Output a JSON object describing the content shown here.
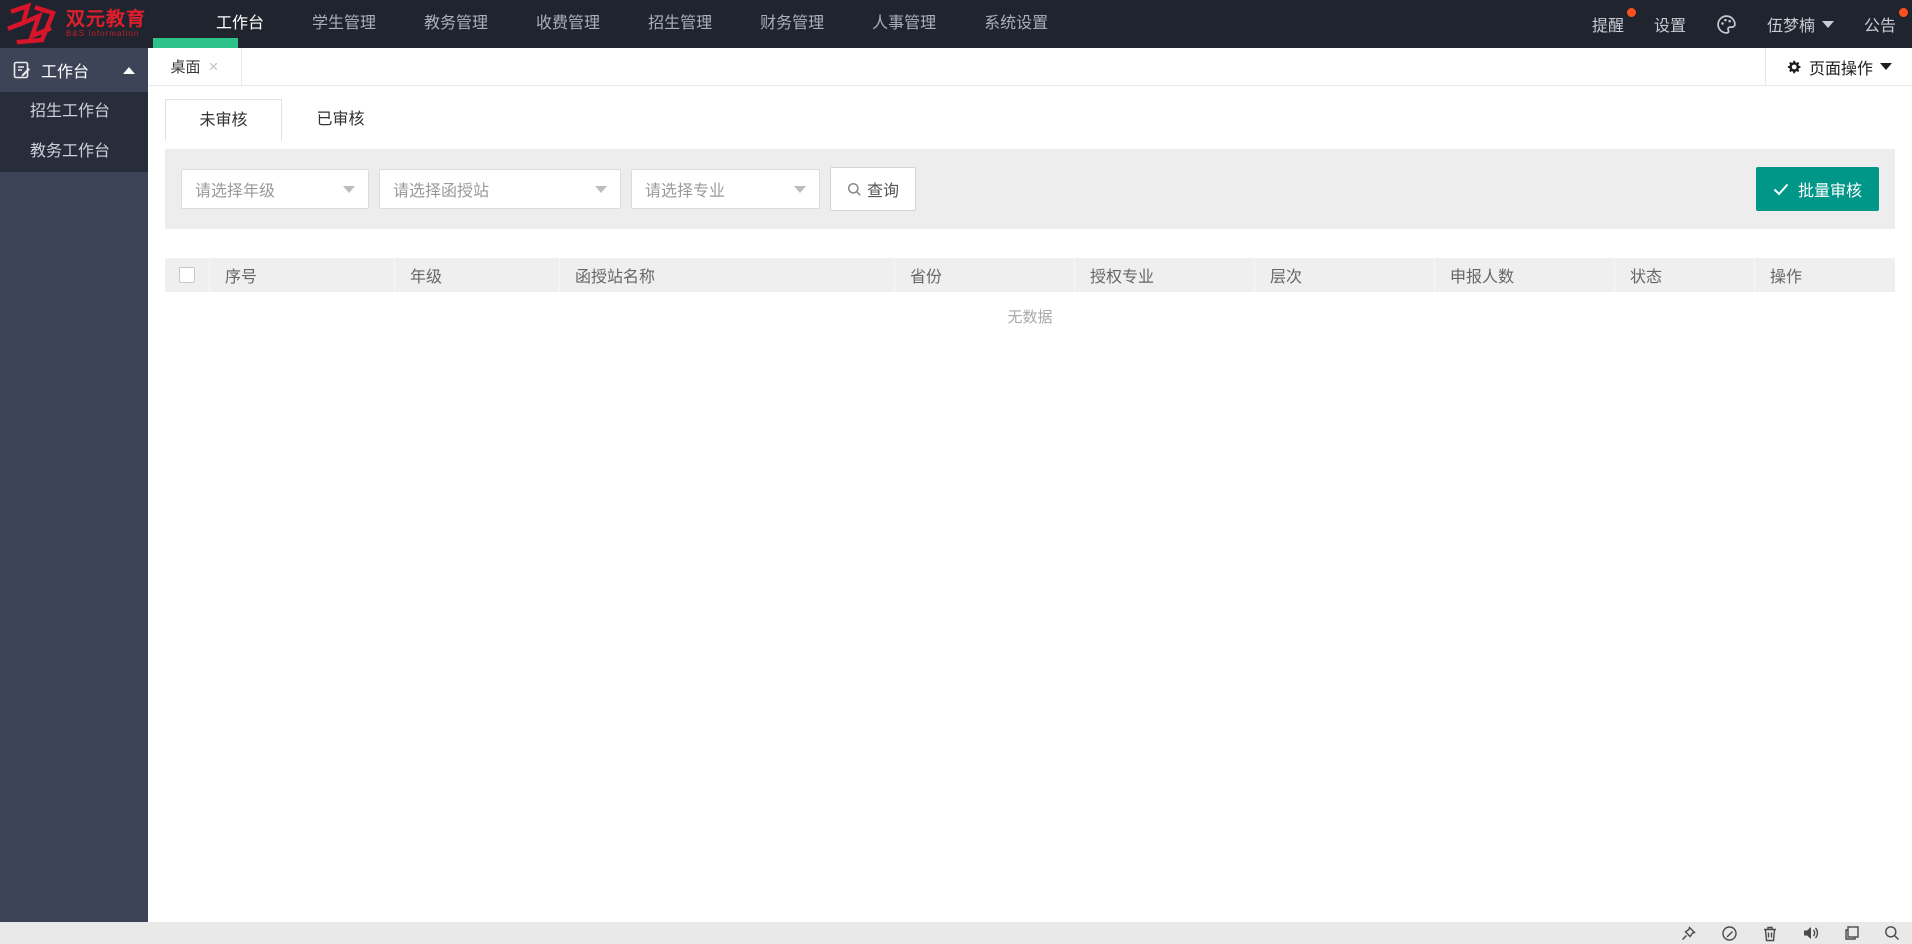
{
  "brand": {
    "name": "双元教育",
    "subtext": "B&S Information"
  },
  "topnav": {
    "items": [
      "工作台",
      "学生管理",
      "教务管理",
      "收费管理",
      "招生管理",
      "财务管理",
      "人事管理",
      "系统设置"
    ],
    "active_item": "工作台",
    "notice": "提醒",
    "settings": "设置",
    "user": "伍梦楠",
    "announcement": "公告"
  },
  "sidebar": {
    "group_label": "工作台",
    "items": [
      "招生工作台",
      "教务工作台"
    ]
  },
  "tabstrip": {
    "tab": "桌面",
    "close": "×",
    "page_ops": "页面操作"
  },
  "content": {
    "tab_unreviewed": "未审核",
    "tab_reviewed": "已审核",
    "filters": {
      "grade_placeholder": "请选择年级",
      "station_placeholder": "请选择函授站",
      "major_placeholder": "请选择专业",
      "search": "查询",
      "batch_review": "批量审核"
    },
    "table": {
      "headers": [
        "序号",
        "年级",
        "函授站名称",
        "省份",
        "授权专业",
        "层次",
        "申报人数",
        "状态",
        "操作"
      ],
      "empty": "无数据",
      "rows": []
    }
  },
  "colors": {
    "accent_green": "#2ec28b",
    "button_teal": "#009688",
    "badge_red": "#ff4f1f",
    "brand_red": "#e01f2d"
  }
}
